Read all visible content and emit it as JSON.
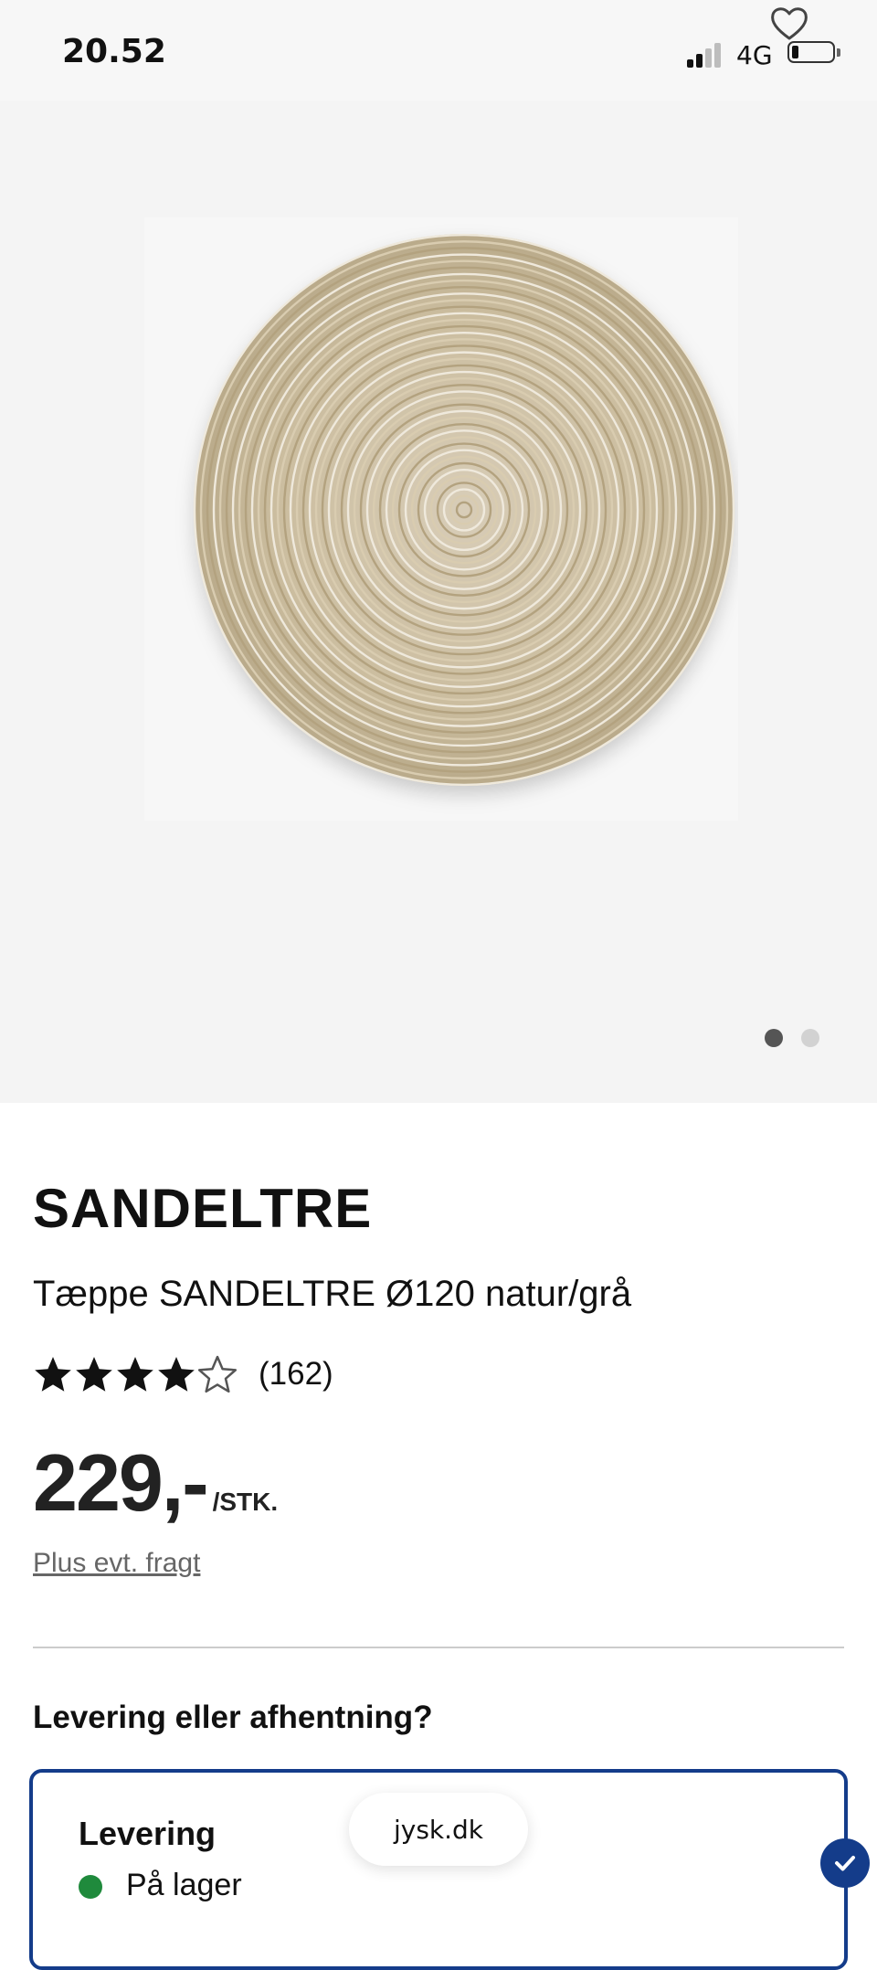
{
  "status_bar": {
    "time": "20.52",
    "network": "4G",
    "signal_bars_active": 2,
    "signal_bars_total": 4,
    "battery_level": 0.15
  },
  "gallery": {
    "favorite_icon": "heart-outline-icon",
    "image_alt": "round braided natural/grey rug",
    "dots_total": 2,
    "active_index": 0
  },
  "product": {
    "brand": "SANDELTRE",
    "name": "Tæppe SANDELTRE Ø120 natur/grå",
    "rating": 4,
    "rating_max": 5,
    "review_count": "(162)",
    "price": "229,-",
    "unit": "/STK.",
    "shipping_link": "Plus evt. fragt"
  },
  "delivery": {
    "heading": "Levering eller afhentning?",
    "option_title": "Levering",
    "stock_status": "På lager",
    "selected": true
  },
  "browser": {
    "url": "jysk.dk"
  },
  "colors": {
    "accent": "#143c8a",
    "in_stock": "#1f8a3c",
    "star": "#111111"
  }
}
